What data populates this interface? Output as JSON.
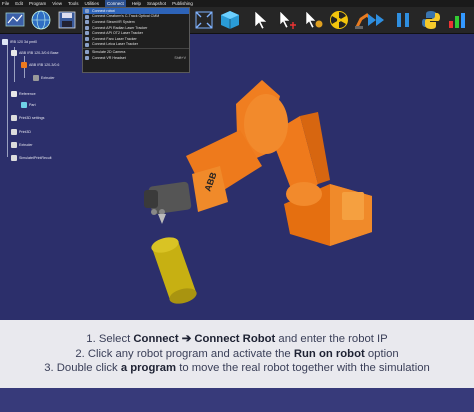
{
  "menu": {
    "items": [
      "File",
      "Edit",
      "Program",
      "View",
      "Tools",
      "Utilities",
      "Connect",
      "Help",
      "Snapshot",
      "Publishing"
    ],
    "active_index": 6
  },
  "connect_menu": {
    "items": [
      {
        "label": "Connect robot",
        "shortcut": "",
        "selected": true
      },
      {
        "label": "Connect Creaform's C-Track Optical CMM",
        "shortcut": ""
      },
      {
        "label": "Connect SteamVR System",
        "shortcut": ""
      },
      {
        "label": "Connect API Radian Laser Tracker",
        "shortcut": ""
      },
      {
        "label": "Connect API OT2 Laser Tracker",
        "shortcut": ""
      },
      {
        "label": "Connect Faro Laser Tracker",
        "shortcut": ""
      },
      {
        "label": "Connect Leica Laser Tracker",
        "shortcut": ""
      },
      {
        "label": "Simulate 2D Camera",
        "shortcut": ""
      },
      {
        "label": "Connect VR Headset",
        "shortcut": "Shift+V"
      }
    ]
  },
  "tree": {
    "items": [
      {
        "label": "IRB 120 3d pmt0",
        "indent": 0
      },
      {
        "label": "ABB IRB 120-3/0.6 Base",
        "indent": 1
      },
      {
        "label": "ABB IRB 120-3/0.6",
        "indent": 2
      },
      {
        "label": "Extruder",
        "indent": 3
      },
      {
        "label": "Reference",
        "indent": 1
      },
      {
        "label": "Part",
        "indent": 2
      },
      {
        "label": "Print3D settings",
        "indent": 1
      },
      {
        "label": "Print3D",
        "indent": 1
      },
      {
        "label": "Extruder",
        "indent": 1
      },
      {
        "label": "SimulateIPrintRecult",
        "indent": 1
      }
    ]
  },
  "robot": {
    "brand_label": "ABB"
  },
  "caption": {
    "line1_pre": "1. Select ",
    "line1_b1": "Connect",
    "line1_arrow": " ➔ ",
    "line1_b2": "Connect Robot",
    "line1_post": " and enter the robot IP",
    "line2_pre": "2. Click any robot program and activate the ",
    "line2_b": "Run on robot",
    "line2_post": " option",
    "line3_pre": "3. Double click ",
    "line3_b": "a program",
    "line3_post": " to move the real robot together with the simulation"
  },
  "colors": {
    "viewport_bg": "#2c2f70",
    "robot_orange": "#f07a1c",
    "robot_dark": "#3a3a3a",
    "cylinder": "#c9b414",
    "caption_bg": "#e9e9ee",
    "menu_highlight": "#2d63b8"
  },
  "toolbar_icons": [
    "new-station-icon",
    "open-globe-icon",
    "save-icon",
    "fit-all-icon",
    "cube-view-icon",
    "select-pointer-icon",
    "move-reference-icon",
    "move-robot-icon",
    "collision-icon",
    "fast-forward-icon",
    "pause-icon",
    "python-icon",
    "chart-icon"
  ]
}
